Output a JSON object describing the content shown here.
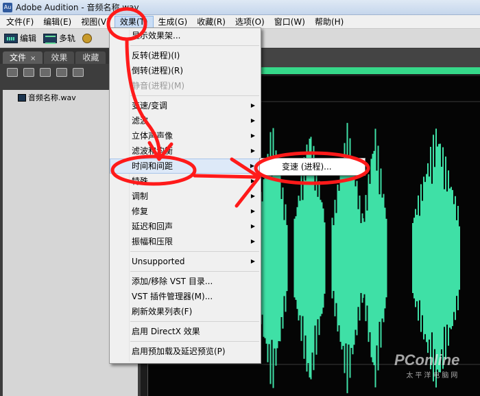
{
  "window": {
    "icon": "Au",
    "title": "Adobe Audition - 音频名称.wav"
  },
  "menubar": {
    "items": [
      "文件(F)",
      "编辑(E)",
      "视图(V)",
      "效果(T)",
      "生成(G)",
      "收藏(R)",
      "选项(O)",
      "窗口(W)",
      "帮助(H)"
    ],
    "active_index": 3
  },
  "toolbar": {
    "edit_label": "编辑",
    "multitrack_label": "多轨"
  },
  "left_panel": {
    "tabs": [
      {
        "label": "文件",
        "close": "×"
      },
      {
        "label": "效果"
      },
      {
        "label": "收藏"
      }
    ],
    "files": [
      "音频名称.wav"
    ]
  },
  "effects_menu": {
    "items": [
      {
        "label": "显示效果架...",
        "type": "item"
      },
      {
        "type": "sep"
      },
      {
        "label": "反转(进程)(I)",
        "type": "item"
      },
      {
        "label": "倒转(进程)(R)",
        "type": "item"
      },
      {
        "label": "静音(进程)(M)",
        "type": "item",
        "disabled": true
      },
      {
        "type": "sep"
      },
      {
        "label": "变速/变调",
        "type": "submenu"
      },
      {
        "label": "滤波",
        "type": "submenu"
      },
      {
        "label": "立体声声像",
        "type": "submenu"
      },
      {
        "label": "滤波和均衡",
        "type": "submenu"
      },
      {
        "label": "时间和间距",
        "type": "submenu",
        "highlight": true
      },
      {
        "label": "特殊",
        "type": "submenu"
      },
      {
        "label": "调制",
        "type": "submenu"
      },
      {
        "label": "修复",
        "type": "submenu"
      },
      {
        "label": "延迟和回声",
        "type": "submenu"
      },
      {
        "label": "振幅和压限",
        "type": "submenu"
      },
      {
        "type": "sep"
      },
      {
        "label": "Unsupported",
        "type": "submenu"
      },
      {
        "type": "sep"
      },
      {
        "label": "添加/移除 VST 目录...",
        "type": "item"
      },
      {
        "label": "VST 插件管理器(M)...",
        "type": "item"
      },
      {
        "label": "刷新效果列表(F)",
        "type": "item"
      },
      {
        "type": "sep"
      },
      {
        "label": "启用 DirectX 效果",
        "type": "item"
      },
      {
        "type": "sep"
      },
      {
        "label": "启用预加载及延迟预览(P)",
        "type": "item"
      }
    ]
  },
  "time_submenu": {
    "items": [
      "变速 (进程)..."
    ]
  },
  "colors": {
    "waveform": "#3fe0a6",
    "annotation": "#ff1a1a",
    "highlight": "#dde9f8"
  },
  "watermark": {
    "main": "PConline",
    "sub": "太平洋电脑网"
  }
}
